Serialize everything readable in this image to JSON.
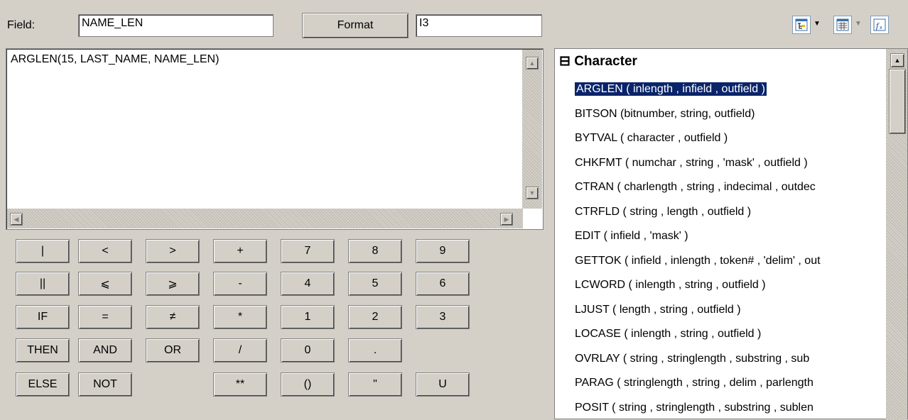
{
  "header": {
    "field_label": "Field:",
    "field_value": "NAME_LEN",
    "format_button": "Format",
    "format_value": "I3"
  },
  "editor": {
    "expression": "ARGLEN(15, LAST_NAME, NAME_LEN)"
  },
  "keypad": {
    "rows": [
      [
        "|",
        "<",
        ">",
        "+",
        "7",
        "8",
        "9"
      ],
      [
        "||",
        "⩽",
        "⩾",
        "-",
        "4",
        "5",
        "6"
      ],
      [
        "IF",
        "=",
        "≠",
        "*",
        "1",
        "2",
        "3"
      ],
      [
        "THEN",
        "AND",
        "OR",
        "/",
        "0",
        "."
      ],
      [
        "ELSE",
        "NOT",
        "**",
        "()",
        "\"",
        "U"
      ]
    ]
  },
  "function_list": {
    "category": "Character",
    "expand_symbol": "⊟",
    "selected_index": 0,
    "items": [
      "ARGLEN ( inlength , infield , outfield )",
      "BITSON (bitnumber, string, outfield)",
      "BYTVAL ( character , outfield )",
      "CHKFMT ( numchar , string , 'mask' , outfield )",
      "CTRAN ( charlength , string , indecimal , outdec",
      "CTRFLD ( string , length , outfield )",
      "EDIT ( infield , 'mask' )",
      "GETTOK ( infield , inlength , token# , 'delim' , out",
      "LCWORD ( inlength , string , outfield )",
      "LJUST ( length , string , outfield )",
      "LOCASE ( inlength , string , outfield )",
      "OVRLAY ( string , stringlength , substring , sub",
      "PARAG ( stringlength , string , delim , parlength",
      "POSIT ( string , stringlength , substring , sublen"
    ]
  },
  "toolbar": {
    "icons": [
      "tree-view-icon",
      "list-view-icon",
      "function-icon"
    ]
  },
  "colors": {
    "selection": "#0a246a",
    "face": "#d4d0c8"
  }
}
